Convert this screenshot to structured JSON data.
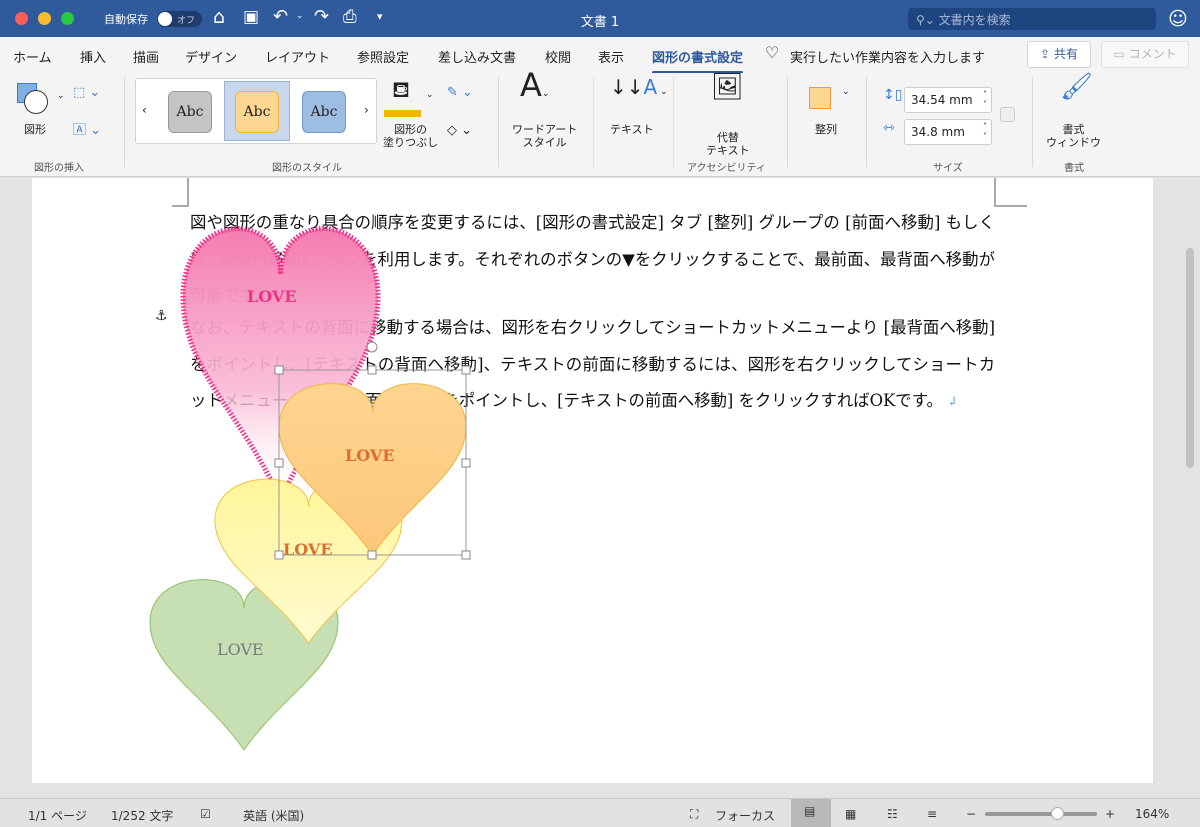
{
  "titlebar": {
    "autosave_label": "自動保存",
    "autosave_state": "オフ",
    "title": "文書 1",
    "search_placeholder": "文書内を検索",
    "icons": [
      "home-icon",
      "save-icon",
      "undo-icon",
      "redo-icon",
      "print-icon",
      "customize-icon",
      "smiley-icon"
    ]
  },
  "tabs": [
    {
      "label": "ホーム"
    },
    {
      "label": "挿入"
    },
    {
      "label": "描画"
    },
    {
      "label": "デザイン"
    },
    {
      "label": "レイアウト"
    },
    {
      "label": "参照設定"
    },
    {
      "label": "差し込み文書"
    },
    {
      "label": "校閲"
    },
    {
      "label": "表示"
    },
    {
      "label": "図形の書式設定",
      "active": true
    }
  ],
  "tell_me": "実行したい作業内容を入力します",
  "share_label": "共有",
  "comment_label": "コメント",
  "ribbon": {
    "insert_shapes": {
      "shapes_label": "図形",
      "group": "図形の挿入"
    },
    "styles": {
      "swatches": [
        {
          "label": "Abc",
          "color": "#c4c4c4"
        },
        {
          "label": "Abc",
          "color": "#fdd692"
        },
        {
          "label": "Abc",
          "color": "#9dbde3"
        }
      ],
      "fill_label": "図形の\n塗りつぶし",
      "group": "図形のスタイル",
      "fill_color": "#f5b800",
      "outline_color": "#70c040"
    },
    "wordart_label": "ワードアート\nスタイル",
    "text_label": "テキスト",
    "alt_text_label": "代替\nテキスト",
    "accessibility_group": "アクセシビリティ",
    "arrange_label": "整列",
    "size": {
      "height": "34.54 mm",
      "width": "34.8 mm",
      "group": "サイズ"
    },
    "format_pane_label": "書式\nウィンドウ",
    "format_group": "書式"
  },
  "document": {
    "paragraphs": [
      "図や図形の重なり具合の順序を変更するには、[図形の書式設定] タブ [整列] グループの [前面へ移動] もしくは [背面へ移動] ボタンを利用します。それぞれのボタンの▼をクリックすることで、最前面、最背面へ移動が可能です。",
      "なお、テキストの背面に移動する場合は、図形を右クリックしてショートカットメニューより [最背面へ移動] をポイントし、[テキストの背面へ移動]、テキストの前面に移動するには、図形を右クリックしてショートカットメニューより [最前面へ移動] をポイントし、[テキストの前面へ移動] をクリックすればOKです。"
    ],
    "shapes": [
      {
        "text": "LOVE",
        "fill": "#f7a8c8",
        "border": "#f0318a",
        "text_color": "#e8358a"
      },
      {
        "text": "LOVE",
        "fill": "#c6dfb3",
        "border": "#8dc060",
        "text_color": "#7a7a7a"
      },
      {
        "text": "LOVE",
        "fill": "#fff8a0",
        "border": "#f2c440",
        "text_color": "#e06a30"
      },
      {
        "text": "LOVE",
        "fill": "#fdd692",
        "border": "#f2b440",
        "text_color": "#e06a30"
      }
    ]
  },
  "status": {
    "page": "1/1 ページ",
    "words": "1/252 文字",
    "language": "英語 (米国)",
    "focus": "フォーカス",
    "zoom": "164%",
    "zoom_level": 0.64
  }
}
